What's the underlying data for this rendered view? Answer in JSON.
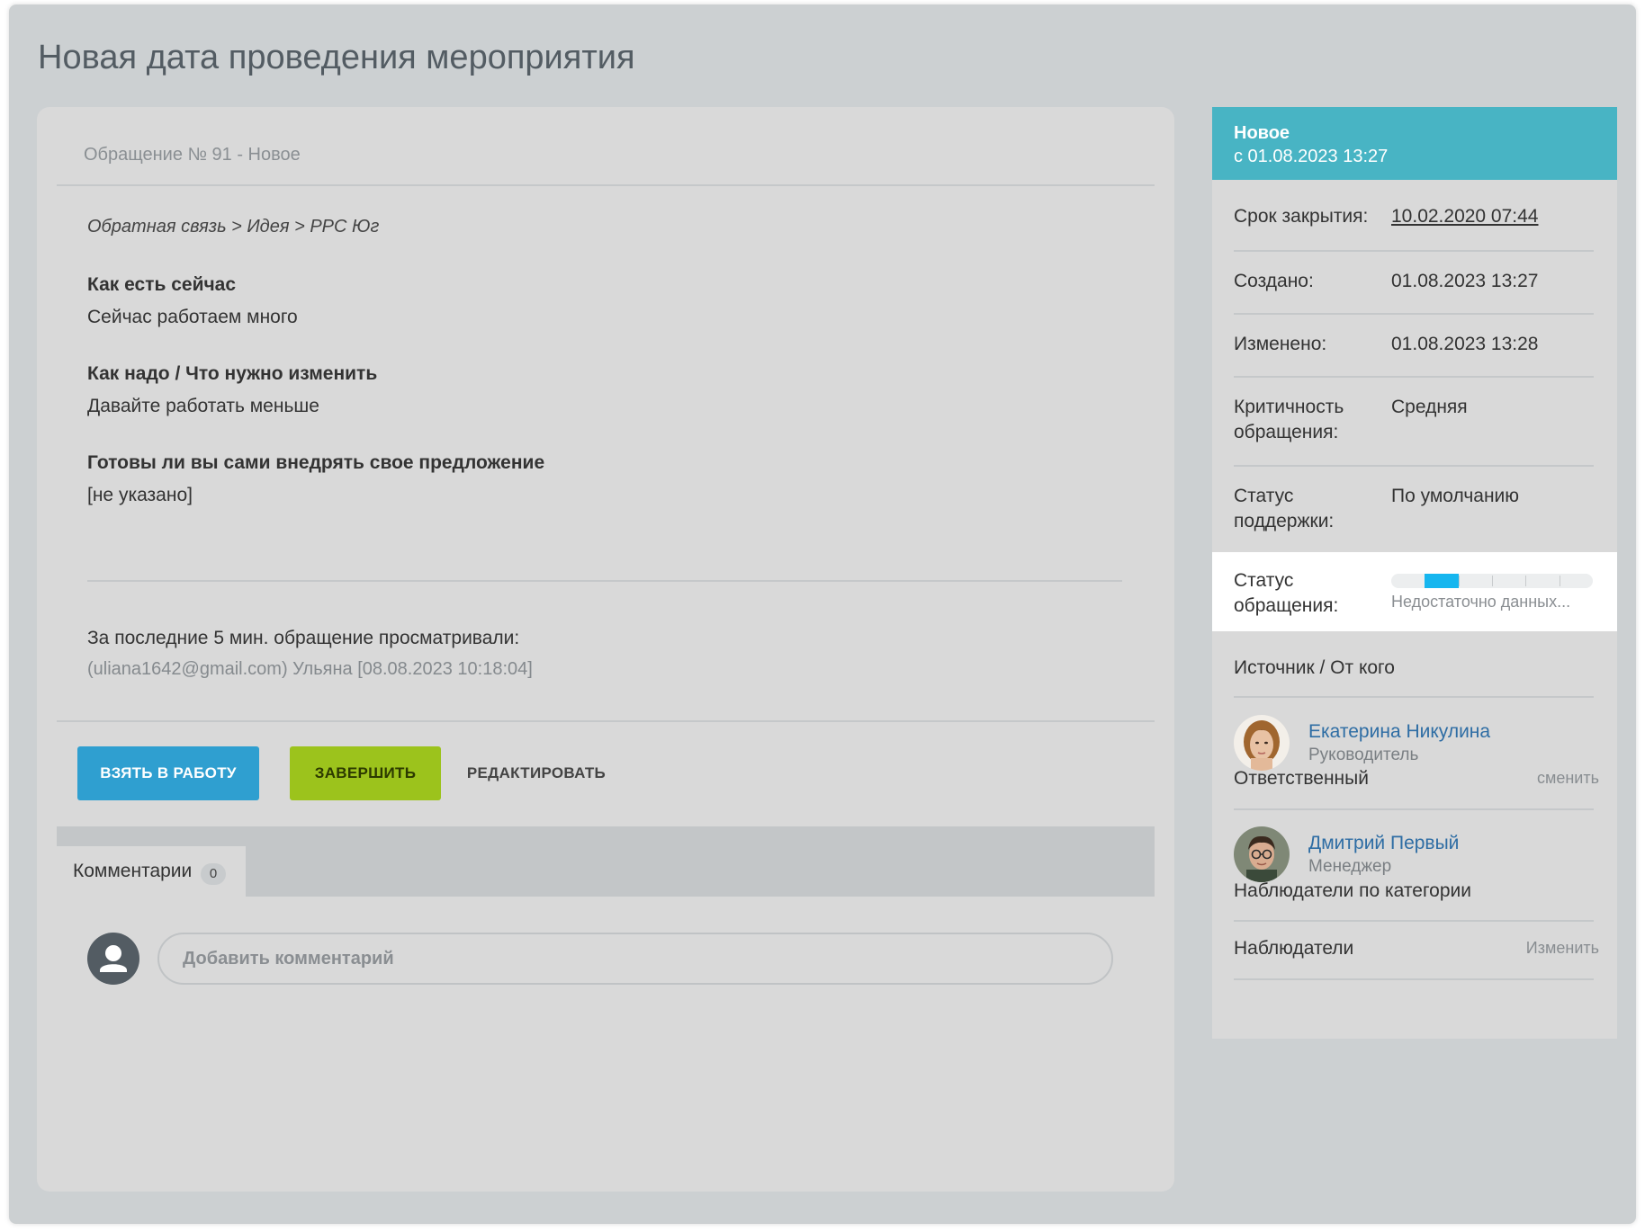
{
  "page": {
    "title": "Новая дата проведения мероприятия"
  },
  "ticket": {
    "header": "Обращение № 91 - Новое",
    "breadcrumb": "Обратная связь > Идея > РРС Юг",
    "fields": [
      {
        "label": "Как есть сейчас",
        "value": "Сейчас работаем много"
      },
      {
        "label": "Как надо / Что нужно изменить",
        "value": "Давайте работать меньше"
      },
      {
        "label": "Готовы ли вы сами внедрять свое предложение",
        "value": "[не указано]"
      }
    ],
    "viewers": {
      "label": "За последние 5 мин. обращение просматривали:",
      "value": "(uliana1642@gmail.com) Ульяна [08.08.2023 10:18:04]"
    }
  },
  "actions": {
    "take": "ВЗЯТЬ В РАБОТУ",
    "finish": "ЗАВЕРШИТЬ",
    "edit": "РЕДАКТИРОВАТЬ"
  },
  "comments": {
    "tab_label": "Комментарии",
    "count": "0",
    "placeholder": "Добавить комментарий"
  },
  "sidebar": {
    "status": {
      "name": "Новое",
      "since": "с 01.08.2023 13:27",
      "color": "#48b4c4"
    },
    "deadline": {
      "label": "Срок закрытия:",
      "value": "10.02.2020 07:44"
    },
    "created": {
      "label": "Создано:",
      "value": "01.08.2023 13:27"
    },
    "modified": {
      "label": "Изменено:",
      "value": "01.08.2023 13:28"
    },
    "criticality": {
      "label_line1": "Критичность",
      "label_line2": "обращения:",
      "value": "Средняя"
    },
    "support_status": {
      "label_line1": "Статус",
      "label_line2": "поддержки:",
      "value": "По умолчанию"
    },
    "ticket_status": {
      "label_line1": "Статус",
      "label_line2": "обращения:",
      "progress_segment": 2,
      "progress_segments_total": 6,
      "progress_color": "#16b6ef",
      "note": "Недостаточно данных..."
    },
    "source": {
      "label": "Источник / От кого",
      "name": "Екатерина Никулина",
      "role": "Руководитель"
    },
    "responsible": {
      "label": "Ответственный",
      "change_link": "сменить",
      "name": "Дмитрий Первый",
      "role": "Менеджер"
    },
    "category_watchers": {
      "label": "Наблюдатели по категории"
    },
    "watchers": {
      "label": "Наблюдатели",
      "change_link": "Изменить"
    }
  }
}
